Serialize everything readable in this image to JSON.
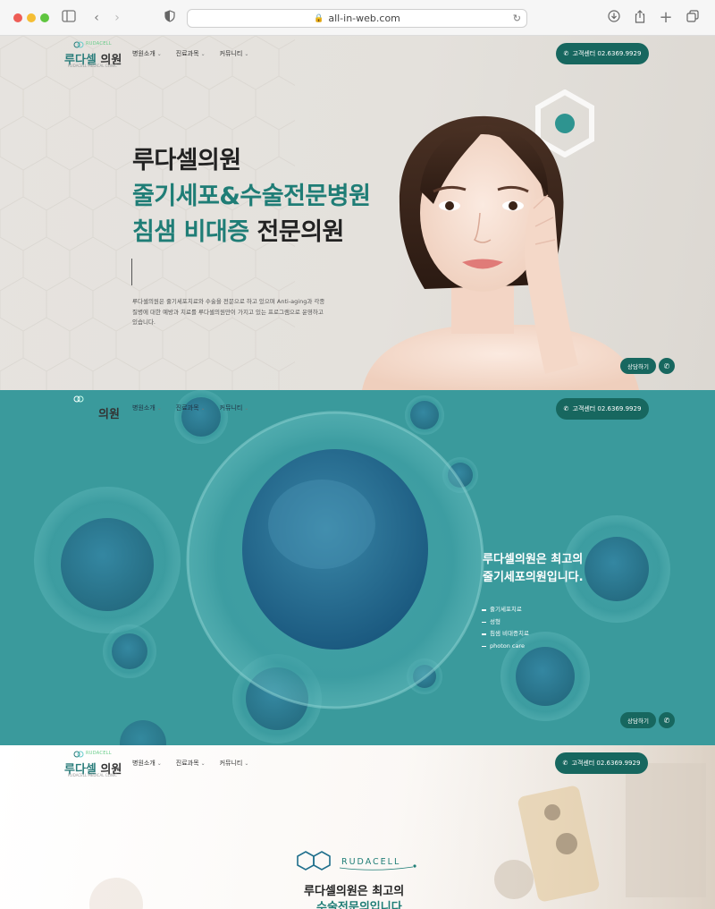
{
  "browser": {
    "url": "all-in-web.com"
  },
  "header": {
    "logo_name_1": "루다셀",
    "logo_name_2": "의원",
    "logo_sub": "RUDACELL",
    "logo_tag": "RUDACELL MEDICAL CLINIC",
    "nav": [
      "병원소개",
      "진료과목",
      "커뮤니티"
    ],
    "call_label": "고객센터 02.6369.9929"
  },
  "hero1": {
    "line1": "루다셀의원",
    "line2": "줄기세포&수술전문병원",
    "line3_highlight": "침샘 비대증",
    "line3_rest": " 전문의원",
    "description": "루다셀의원은 줄기세포치료와 수술을 전문으로 하고 있으며 Anti-aging과 각종 질병에 대한 예방과 치료를 루다셀의원만이 가지고 있는 프로그램으로 운영하고 있습니다.",
    "consult_label": "상담하기"
  },
  "hero2": {
    "title_line1": "루다셀의원은 최고의",
    "title_line2": "줄기세포의원입니다.",
    "list": [
      "줄기세포치료",
      "성형",
      "침샘 비대증치료",
      "photon care"
    ],
    "consult_label": "상담하기"
  },
  "hero3": {
    "brand": "RUDACELL",
    "title_line1": "루다셀의원은 최고의",
    "title_line2": "수술전문의입니다"
  },
  "colors": {
    "brand_green": "#17675f",
    "accent_teal": "#1f7d76",
    "section2_bg": "#3a9a9c"
  }
}
